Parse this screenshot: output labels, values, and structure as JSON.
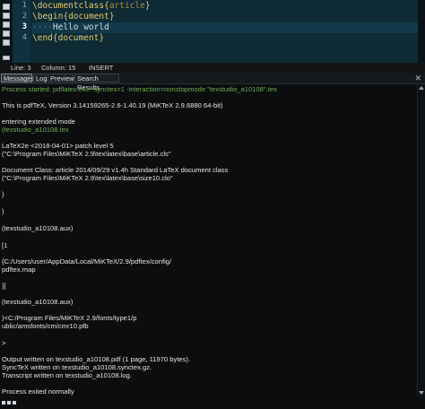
{
  "editor": {
    "line_numbers": [
      "1",
      "2",
      "3",
      "4"
    ],
    "lines": [
      {
        "cmd": "\\documentclass",
        "open": "{",
        "arg": "article",
        "close": "}"
      },
      {
        "cmd": "\\begin",
        "open": "{",
        "arg": "document",
        "close": "}"
      },
      {
        "dots": "····",
        "text": "Hello world"
      },
      {
        "cmd": "\\end",
        "open": "{",
        "arg": "document",
        "close": "}"
      }
    ]
  },
  "status": {
    "line": "Line: 3",
    "column": "Column: 15",
    "mode": "INSERT"
  },
  "tabs": [
    "Messages",
    "Log",
    "Preview",
    "Search Results"
  ],
  "log_lines": [
    {
      "text": "Process started: pdflatex.exe -synctex=1 -interaction=nonstopmode \"texstudio_a10108\".tex",
      "color": "green"
    },
    {
      "text": "This is pdfTeX, Version 3.14159265-2.6-1.40.19 (MiKTeX 2.9.6880 64-bit)"
    },
    {
      "text": "entering extended mode"
    },
    {
      "text": "(texstudio_a10108.tex",
      "color": "green"
    },
    {
      "text": "LaTeX2e <2018-04-01> patch level 5"
    },
    {
      "text": "(\"C:\\Program Files\\MiKTeX 2.9\\tex\\latex\\base\\article.cls\""
    },
    {
      "text": "Document Class: article 2014/09/29 v1.4h Standard LaTeX document class"
    },
    {
      "text": "(\"C:\\Program Files\\MiKTeX 2.9\\tex\\latex\\base\\size10.clo\""
    },
    {
      "text": ")"
    },
    {
      "text": ")"
    },
    {
      "text": "(texstudio_a10108.aux)"
    },
    {
      "text": "[1"
    },
    {
      "text": "{C:/Users/user/AppData/Local/MiKTeX/2.9/pdftex/config/"
    },
    {
      "text": "pdftex.map"
    },
    {
      "text": "}]"
    },
    {
      "text": "(texstudio_a10108.aux)"
    },
    {
      "text": ")<C:/Program Files/MiKTeX 2.9/fonts/type1/p"
    },
    {
      "text": "ublic/amsfonts/cm/cmr10.pfb"
    },
    {
      "text": ">"
    },
    {
      "text": "Output written on texstudio_a10108.pdf (1 page, 11970 bytes)."
    },
    {
      "text": "SyncTeX written on texstudio_a10108.synctex.gz."
    },
    {
      "text": "Transcript written on texstudio_a10108.log."
    },
    {
      "text": "Process exited normally"
    }
  ]
}
